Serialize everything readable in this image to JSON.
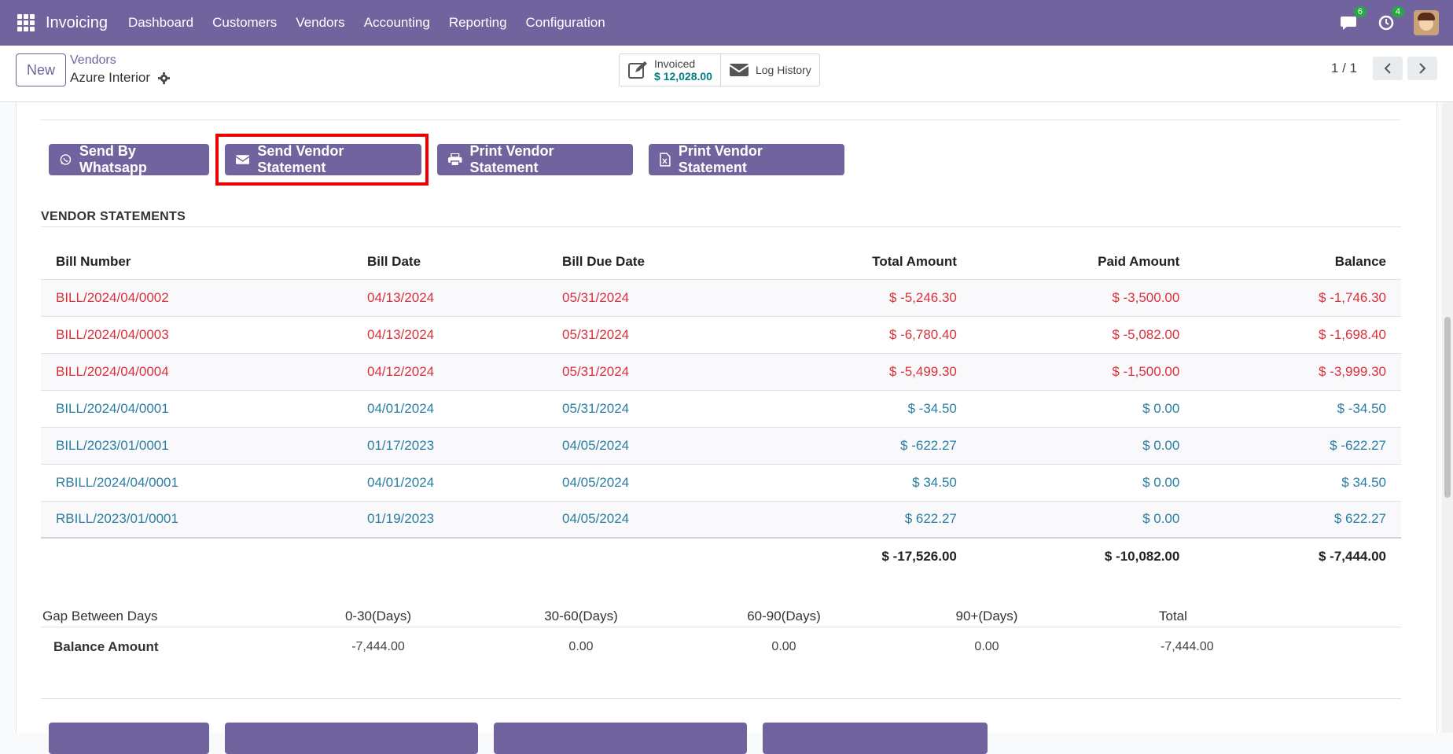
{
  "navbar": {
    "app_title": "Invoicing",
    "menu": [
      "Dashboard",
      "Customers",
      "Vendors",
      "Accounting",
      "Reporting",
      "Configuration"
    ],
    "messages_count": "6",
    "activities_count": "4",
    "icons": [
      "apps-grid-icon",
      "chat-icon",
      "clock-icon",
      "avatar"
    ]
  },
  "control": {
    "new_label": "New",
    "breadcrumb_parent": "Vendors",
    "breadcrumb_current": "Azure Interior",
    "invoiced_label": "Invoiced",
    "invoiced_value": "$ 12,028.00",
    "log_history_label": "Log History",
    "pager": "1 / 1"
  },
  "actions": {
    "whatsapp": "Send By Whatsapp",
    "send_statement": "Send Vendor Statement",
    "print_statement": "Print Vendor Statement",
    "print_statement_xls": "Print Vendor Statement"
  },
  "statements": {
    "title": "VENDOR STATEMENTS",
    "headers": [
      "Bill Number",
      "Bill Date",
      "Bill Due Date",
      "Total Amount",
      "Paid Amount",
      "Balance"
    ],
    "rows": [
      {
        "bill": "BILL/2024/04/0002",
        "date": "04/13/2024",
        "due": "05/31/2024",
        "total": "$ -5,246.30",
        "paid": "$ -3,500.00",
        "balance": "$ -1,746.30",
        "status": "overdue"
      },
      {
        "bill": "BILL/2024/04/0003",
        "date": "04/13/2024",
        "due": "05/31/2024",
        "total": "$ -6,780.40",
        "paid": "$ -5,082.00",
        "balance": "$ -1,698.40",
        "status": "overdue"
      },
      {
        "bill": "BILL/2024/04/0004",
        "date": "04/12/2024",
        "due": "05/31/2024",
        "total": "$ -5,499.30",
        "paid": "$ -1,500.00",
        "balance": "$ -3,999.30",
        "status": "overdue"
      },
      {
        "bill": "BILL/2024/04/0001",
        "date": "04/01/2024",
        "due": "05/31/2024",
        "total": "$ -34.50",
        "paid": "$ 0.00",
        "balance": "$ -34.50",
        "status": "normal"
      },
      {
        "bill": "BILL/2023/01/0001",
        "date": "01/17/2023",
        "due": "04/05/2024",
        "total": "$ -622.27",
        "paid": "$ 0.00",
        "balance": "$ -622.27",
        "status": "normal"
      },
      {
        "bill": "RBILL/2024/04/0001",
        "date": "04/01/2024",
        "due": "04/05/2024",
        "total": "$ 34.50",
        "paid": "$ 0.00",
        "balance": "$ 34.50",
        "status": "normal"
      },
      {
        "bill": "RBILL/2023/01/0001",
        "date": "01/19/2023",
        "due": "04/05/2024",
        "total": "$ 622.27",
        "paid": "$ 0.00",
        "balance": "$ 622.27",
        "status": "normal"
      }
    ],
    "totals": {
      "total": "$ -17,526.00",
      "paid": "$ -10,082.00",
      "balance": "$ -7,444.00"
    }
  },
  "aging": {
    "headers": [
      "Gap Between Days",
      "0-30(Days)",
      "30-60(Days)",
      "60-90(Days)",
      "90+(Days)",
      "Total"
    ],
    "row_label": "Balance Amount",
    "values": [
      "-7,444.00",
      "0.00",
      "0.00",
      "0.00",
      "-7,444.00"
    ]
  },
  "colors": {
    "brand": "#71639e",
    "overdue_text": "#d9313b",
    "normal_text": "#2a7ea1",
    "highlight_box": "#ee0000"
  }
}
